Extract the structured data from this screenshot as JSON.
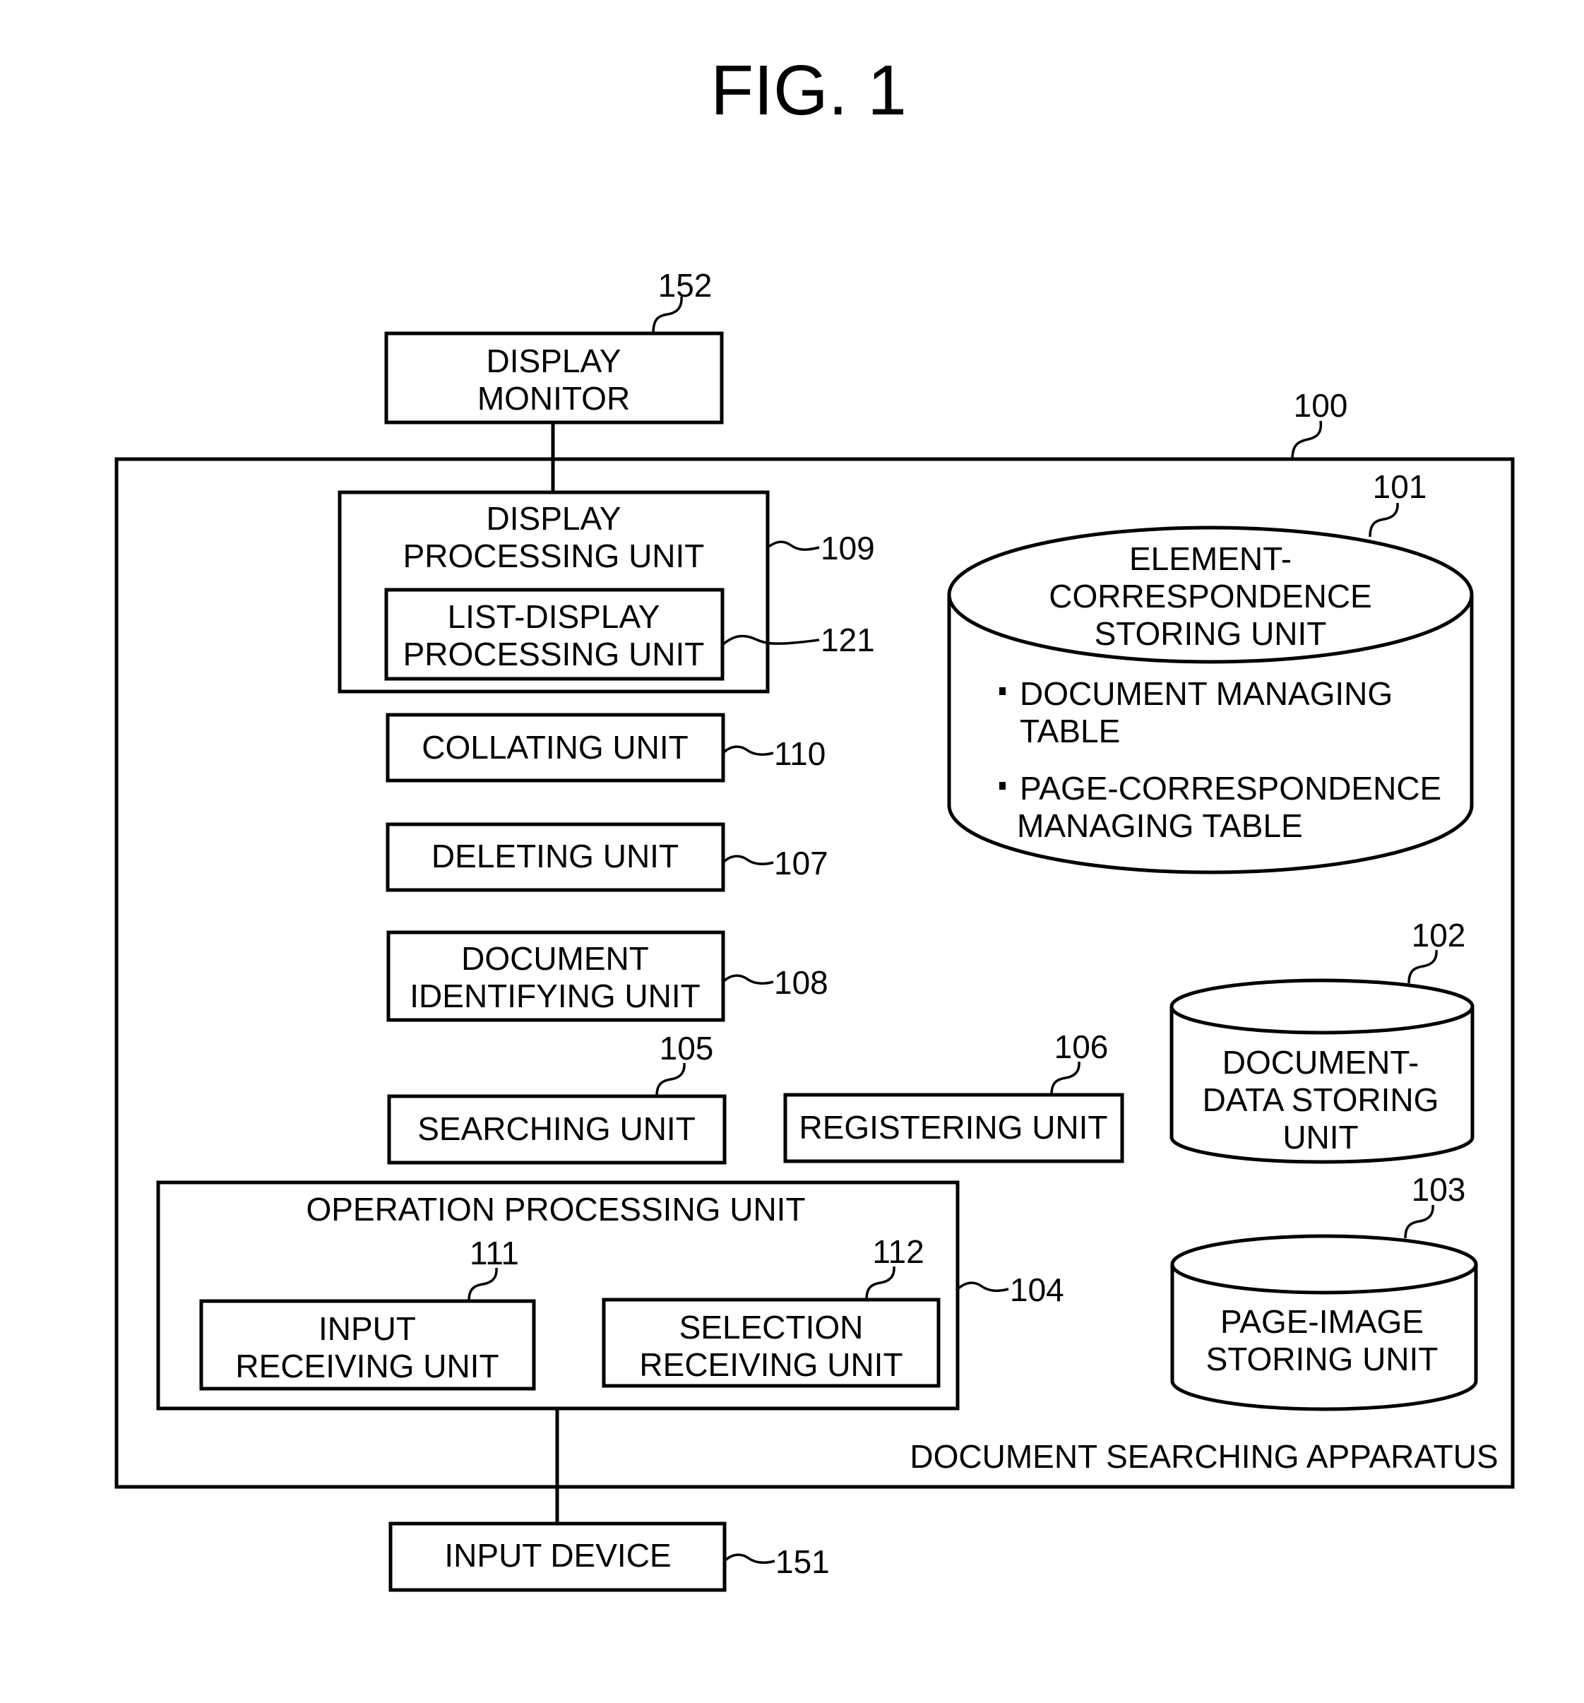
{
  "figure": {
    "title": "FIG. 1"
  },
  "apparatus": {
    "ref": "100",
    "label": "DOCUMENT SEARCHING APPARATUS"
  },
  "display_monitor": {
    "ref": "152",
    "lines": [
      "DISPLAY",
      "MONITOR"
    ]
  },
  "display_processing_unit": {
    "ref": "109",
    "lines": [
      "DISPLAY",
      "PROCESSING UNIT"
    ],
    "child": {
      "ref": "121",
      "lines": [
        "LIST-DISPLAY",
        "PROCESSING UNIT"
      ]
    }
  },
  "collating_unit": {
    "ref": "110",
    "label": "COLLATING UNIT"
  },
  "deleting_unit": {
    "ref": "107",
    "label": "DELETING UNIT"
  },
  "document_identifying_unit": {
    "ref": "108",
    "lines": [
      "DOCUMENT",
      "IDENTIFYING UNIT"
    ]
  },
  "searching_unit": {
    "ref": "105",
    "label": "SEARCHING UNIT"
  },
  "registering_unit": {
    "ref": "106",
    "label": "REGISTERING UNIT"
  },
  "operation_processing_unit": {
    "ref": "104",
    "label": "OPERATION PROCESSING UNIT",
    "input_receiving_unit": {
      "ref": "111",
      "lines": [
        "INPUT",
        "RECEIVING UNIT"
      ]
    },
    "selection_receiving_unit": {
      "ref": "112",
      "lines": [
        "SELECTION",
        "RECEIVING UNIT"
      ]
    }
  },
  "input_device": {
    "ref": "151",
    "label": "INPUT DEVICE"
  },
  "element_correspondence_storing_unit": {
    "ref": "101",
    "lines": [
      "ELEMENT-",
      "CORRESPONDENCE",
      "STORING UNIT"
    ],
    "items": [
      {
        "bullet": "•",
        "lines": [
          "DOCUMENT MANAGING",
          "TABLE"
        ]
      },
      {
        "bullet": "•",
        "lines": [
          "PAGE-CORRESPONDENCE",
          "MANAGING TABLE"
        ]
      }
    ]
  },
  "document_data_storing_unit": {
    "ref": "102",
    "lines": [
      "DOCUMENT-",
      "DATA STORING",
      "UNIT"
    ]
  },
  "page_image_storing_unit": {
    "ref": "103",
    "lines": [
      "PAGE-IMAGE",
      "STORING UNIT"
    ]
  }
}
